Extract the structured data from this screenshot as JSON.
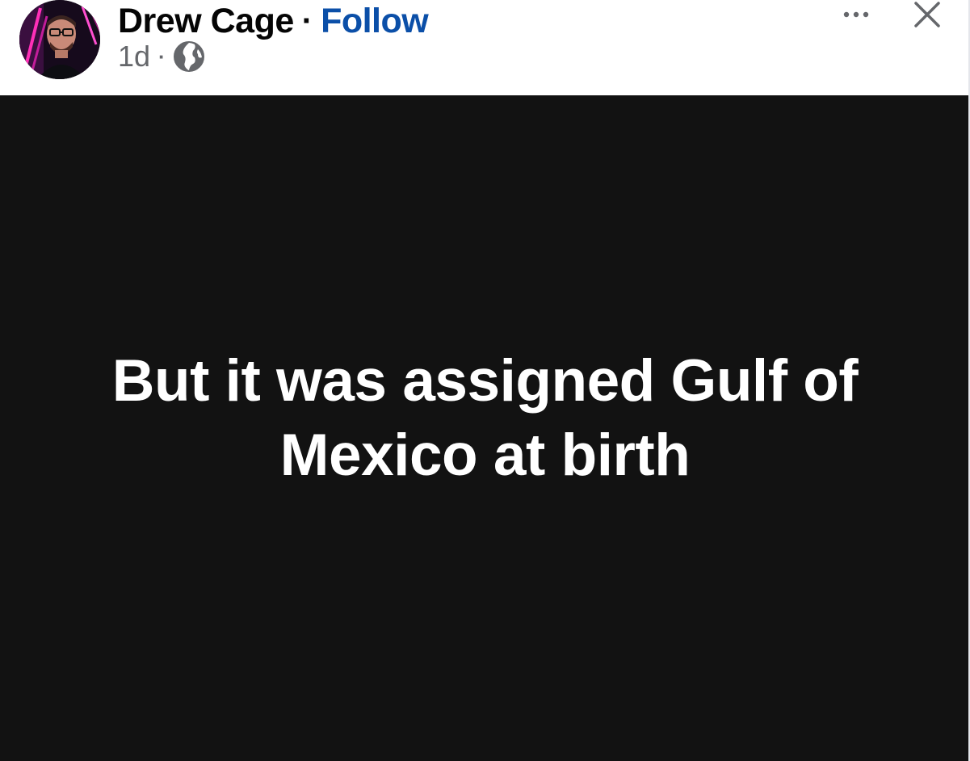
{
  "post": {
    "author": {
      "name": "Drew Cage",
      "avatar_icon": "profile-photo",
      "follow_label": "Follow",
      "separator": "·"
    },
    "meta": {
      "time": "1d",
      "separator": "·",
      "audience_icon": "globe-icon"
    },
    "actions": {
      "more_icon": "more-options-icon",
      "close_icon": "close-icon"
    },
    "text": "But it was assigned Gulf of Mexico at birth",
    "colors": {
      "background": "#121212",
      "text": "#ffffff",
      "follow": "#0b4fa8",
      "meta": "#65676b"
    }
  }
}
